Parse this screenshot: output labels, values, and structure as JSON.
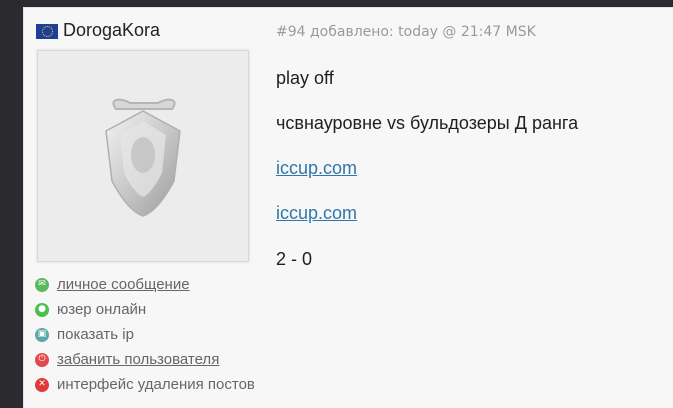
{
  "post": {
    "username": "DorogaKora",
    "meta": "#94 добавлено: today @ 21:47 MSK",
    "lines": [
      {
        "text": "play off",
        "link": false
      },
      {
        "text": "чсвнауровне vs бульдозеры Д ранга",
        "link": false
      },
      {
        "text": "iccup.com",
        "link": true
      },
      {
        "text": "iccup.com",
        "link": true
      },
      {
        "text": "2 - 0",
        "link": false
      }
    ]
  },
  "actions": [
    {
      "label": "личное сообщение",
      "icon": "envelope-icon",
      "color": "#5cb85c",
      "link": true
    },
    {
      "label": "юзер онлайн",
      "icon": "online-dot-icon",
      "color": "#4cbf4c",
      "link": false
    },
    {
      "label": "показать ip",
      "icon": "monitor-icon",
      "color": "#5aa9a6",
      "link": false
    },
    {
      "label": "забанить пользователя",
      "icon": "power-icon",
      "color": "#e24a4a",
      "link": true
    },
    {
      "label": "интерфейс удаления постов",
      "icon": "close-circle-icon",
      "color": "#e03b3b",
      "link": false
    }
  ]
}
